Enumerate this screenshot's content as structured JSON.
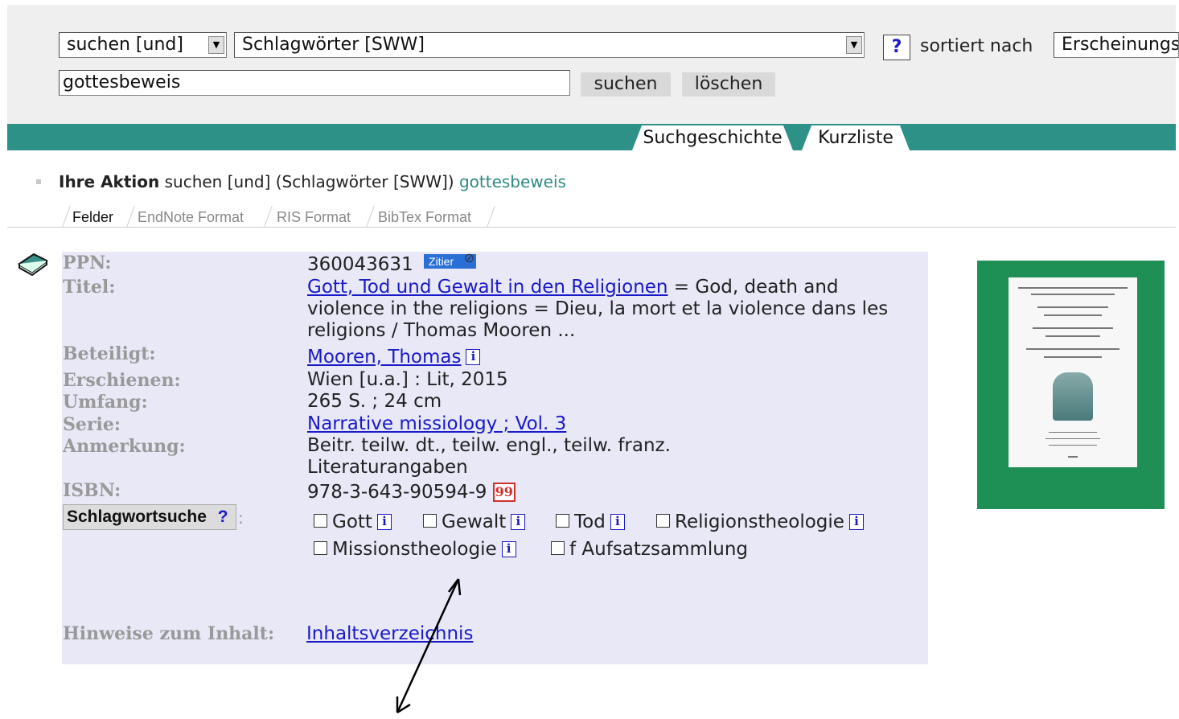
{
  "search": {
    "operator": "suchen [und]",
    "field": "Schlagwörter [SWW]",
    "help": "?",
    "sort_label": "sortiert nach",
    "sort_value": "Erscheinungsj",
    "query": "gottesbeweis",
    "search_button": "suchen",
    "clear_button": "löschen"
  },
  "tabs": [
    "Suchgeschichte",
    "Kurzliste"
  ],
  "action": {
    "label": "Ihre Aktion",
    "text": "suchen [und] (Schlagwörter [SWW])",
    "term": "gottesbeweis"
  },
  "format_tabs": [
    "Felder",
    "EndNote Format",
    "RIS Format",
    "BibTex Format"
  ],
  "record": {
    "labels": {
      "ppn": "PPN:",
      "titel": "Titel:",
      "beteiligt": "Beteiligt:",
      "erschienen": "Erschienen:",
      "umfang": "Umfang:",
      "serie": "Serie:",
      "anmerkung": "Anmerkung:",
      "isbn": "ISBN:",
      "schlagwortsuche": "Schlagwortsuche",
      "schlagwortsuche_help": "?",
      "colon": ":",
      "hinweise": "Hinweise zum Inhalt:"
    },
    "ppn": "360043631",
    "zitier": "Zitier",
    "title_link": "Gott, Tod und Gewalt in den Religionen",
    "title_line1_rest": " = God, death and",
    "title_line2": "violence in the religions = Dieu, la mort et la violence dans les",
    "title_line3": "religions / Thomas Mooren ...",
    "author": "Mooren, Thomas",
    "published": "Wien [u.a.] : Lit, 2015",
    "extent": "265 S. ; 24 cm",
    "series": "Narrative missiology ; Vol. 3",
    "note_line1": "Beitr. teilw. dt., teilw. engl., teilw. franz.",
    "note_line2": "Literaturangaben",
    "isbn": "978-3-643-90594-9",
    "isbn_icon": "99",
    "keywords": [
      "Gott",
      "Gewalt",
      "Tod",
      "Religionstheologie",
      "Missionstheologie",
      "f Aufsatzsammlung"
    ],
    "info_icon": "i",
    "contents_link": "Inhaltsverzeichnis"
  },
  "colors": {
    "teal_bar": "#2e9187",
    "record_bg": "#e8e8f7",
    "link": "#1a1ac8",
    "cover": "#1e8f55"
  }
}
